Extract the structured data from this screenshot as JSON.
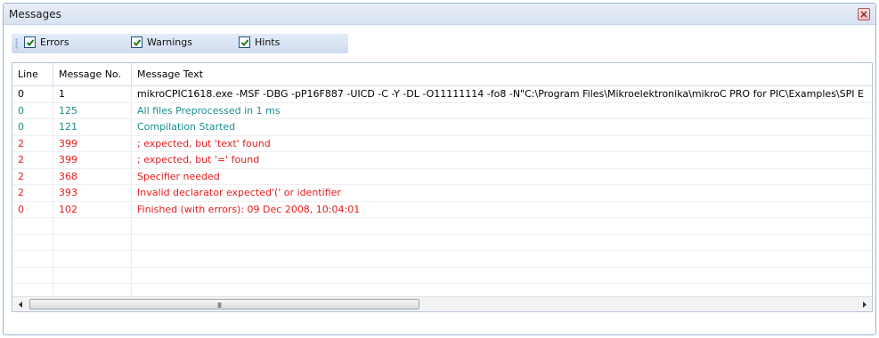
{
  "panel": {
    "title": "Messages"
  },
  "filters": [
    {
      "label": "Errors",
      "checked": true
    },
    {
      "label": "Warnings",
      "checked": true
    },
    {
      "label": "Hints",
      "checked": true
    }
  ],
  "table": {
    "columns": [
      "Line",
      "Message No.",
      "Message Text"
    ],
    "rows": [
      {
        "line": "0",
        "no": "1",
        "text": "mikroCPIC1618.exe -MSF -DBG -pP16F887 -UICD -C -Y -DL -O11111114 -fo8 -N\"C:\\Program Files\\Mikroelektronika\\mikroC PRO for PIC\\Examples\\SPI E",
        "color": "#000000"
      },
      {
        "line": "0",
        "no": "125",
        "text": "All files Preprocessed in 1 ms",
        "color": "#1a8f8f"
      },
      {
        "line": "0",
        "no": "121",
        "text": "Compilation Started",
        "color": "#1a8f8f"
      },
      {
        "line": "2",
        "no": "399",
        "text": "; expected, but 'text' found",
        "color": "#e41b1b"
      },
      {
        "line": "2",
        "no": "399",
        "text": "; expected, but '=' found",
        "color": "#e41b1b"
      },
      {
        "line": "2",
        "no": "368",
        "text": "Specifier needed",
        "color": "#e41b1b"
      },
      {
        "line": "2",
        "no": "393",
        "text": "Invalid declarator expected'(' or identifier",
        "color": "#e41b1b"
      },
      {
        "line": "0",
        "no": "102",
        "text": "Finished (with errors): 09 Dec 2008, 10:04:01",
        "color": "#e41b1b"
      },
      {
        "line": "",
        "no": "",
        "text": "",
        "color": "#000000"
      },
      {
        "line": "",
        "no": "",
        "text": "",
        "color": "#000000"
      },
      {
        "line": "",
        "no": "",
        "text": "",
        "color": "#000000"
      },
      {
        "line": "",
        "no": "",
        "text": "",
        "color": "#000000"
      },
      {
        "line": "",
        "no": "",
        "text": "",
        "color": "#000000"
      }
    ]
  },
  "scrollbar": {
    "grip": "III",
    "icons": {
      "left": "arrow-left-icon",
      "right": "arrow-right-icon"
    }
  }
}
